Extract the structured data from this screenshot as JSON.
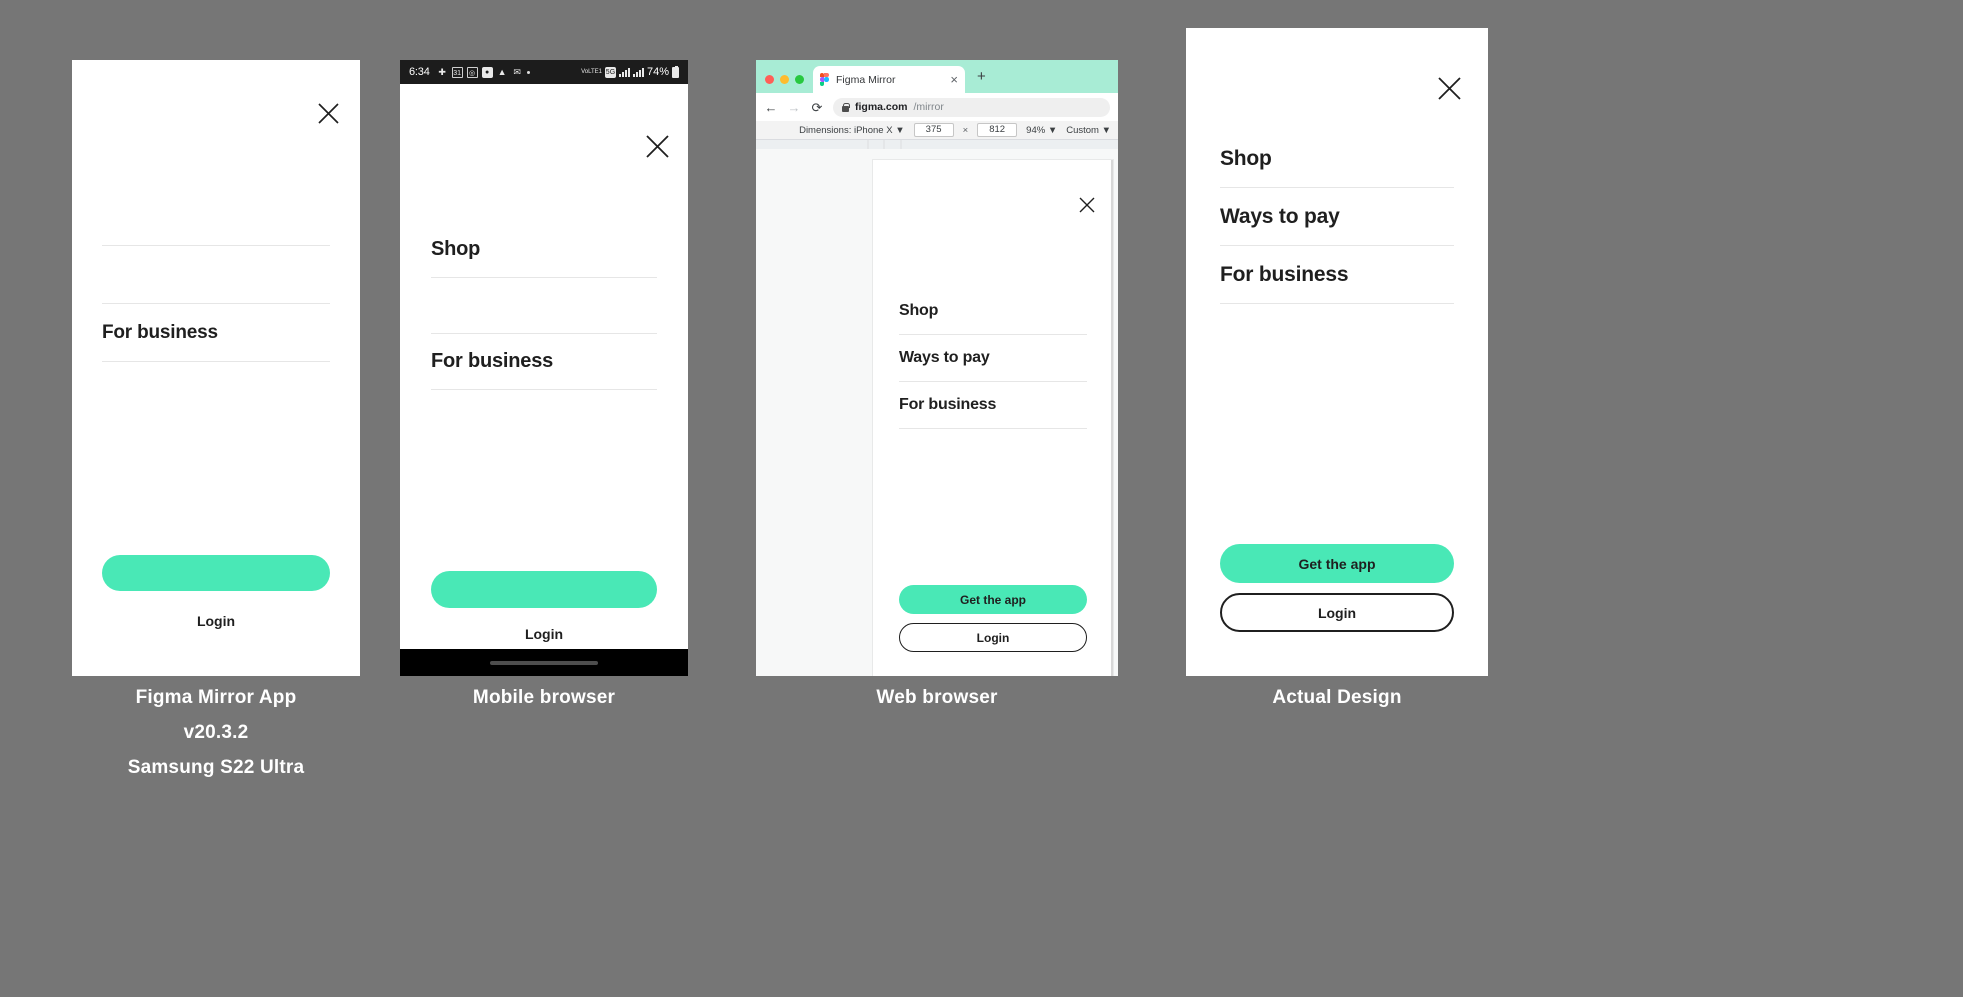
{
  "accent_color": "#49E8B6",
  "background_color": "#767676",
  "menu": {
    "items": [
      "Shop",
      "Ways to pay",
      "For business"
    ],
    "primary_label": "Get the app",
    "secondary_label": "Login",
    "close_icon": "close-x-icon"
  },
  "panels": [
    {
      "id": "figma-mirror-app",
      "caption_lines": [
        "Figma Mirror App",
        "v20.3.2",
        "Samsung S22 Ultra"
      ],
      "rendered_items": [
        "",
        "",
        "For business"
      ],
      "primary_label": "",
      "secondary_label": "Login"
    },
    {
      "id": "mobile-browser",
      "caption_lines": [
        "Mobile browser"
      ],
      "rendered_items": [
        "Shop",
        "",
        "For business"
      ],
      "primary_label": "",
      "secondary_label": "Login",
      "status_bar": {
        "time": "6:34",
        "icons": [
          "slack-icon",
          "calendar-31-icon",
          "instagram-icon",
          "app-icon",
          "drive-icon",
          "gmail-icon",
          "dot-icon"
        ],
        "calendar_day": "31",
        "network_volte": "VoLTE1",
        "network_5g": "5G",
        "battery_percent": "74%"
      },
      "nav_bar": "gesture-pill"
    },
    {
      "id": "web-browser",
      "caption_lines": [
        "Web browser"
      ],
      "rendered_items": [
        "Shop",
        "Ways to pay",
        "For business"
      ],
      "primary_label": "Get the app",
      "secondary_label": "Login",
      "browser": {
        "tab_title": "Figma Mirror",
        "tab_close": "×",
        "new_tab": "+",
        "back": "←",
        "forward": "→",
        "reload": "⟳",
        "url_domain": "figma.com",
        "url_path": "/mirror"
      },
      "devtools": {
        "dimensions_label": "Dimensions: iPhone X",
        "width": "375",
        "times": "×",
        "height": "812",
        "zoom": "94%",
        "throttle": "Custom",
        "caret": "▼"
      }
    },
    {
      "id": "actual-design",
      "caption_lines": [
        "Actual Design"
      ],
      "rendered_items": [
        "Shop",
        "Ways to pay",
        "For business"
      ],
      "primary_label": "Get the app",
      "secondary_label": "Login"
    }
  ]
}
